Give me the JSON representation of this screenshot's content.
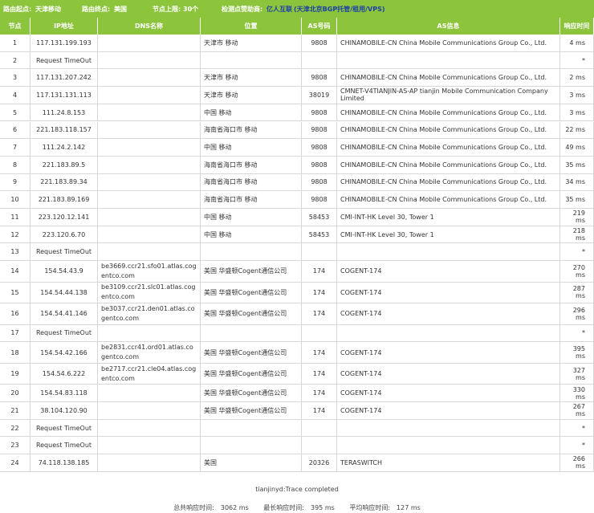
{
  "topbar": {
    "start_label": "路由起点:",
    "start_value": "天津移动",
    "end_label": "路由终点:",
    "end_value": "美国",
    "limit_label": "节点上限:",
    "limit_value": "30个",
    "sponsor_label": "检测点赞助商:",
    "sponsor_name": "亿人互联",
    "sponsor_desc": "(天津北京BGP托管/租用/VPS)"
  },
  "table": {
    "headers": [
      "节点",
      "IP地址",
      "DNS名称",
      "位置",
      "AS号码",
      "AS信息",
      "响应时间"
    ],
    "rows": [
      {
        "n": "1",
        "ip": "117.131.199.193",
        "dns": "",
        "loc": "天津市 移动",
        "as": "9808",
        "info": "CHINAMOBILE-CN China Mobile Communications Group Co., Ltd.",
        "t": "4 ms"
      },
      {
        "n": "2",
        "ip": "Request TimeOut",
        "dns": "",
        "loc": "",
        "as": "",
        "info": "",
        "t": "*"
      },
      {
        "n": "3",
        "ip": "117.131.207.242",
        "dns": "",
        "loc": "天津市 移动",
        "as": "9808",
        "info": "CHINAMOBILE-CN China Mobile Communications Group Co., Ltd.",
        "t": "2 ms"
      },
      {
        "n": "4",
        "ip": "117.131.131.113",
        "dns": "",
        "loc": "天津市 移动",
        "as": "38019",
        "info": "CMNET-V4TIANJIN-AS-AP tianjin Mobile Communication Company Limited",
        "t": "3 ms"
      },
      {
        "n": "5",
        "ip": "111.24.8.153",
        "dns": "",
        "loc": "中国 移动",
        "as": "9808",
        "info": "CHINAMOBILE-CN China Mobile Communications Group Co., Ltd.",
        "t": "3 ms"
      },
      {
        "n": "6",
        "ip": "221.183.118.157",
        "dns": "",
        "loc": "海南省海口市 移动",
        "as": "9808",
        "info": "CHINAMOBILE-CN China Mobile Communications Group Co., Ltd.",
        "t": "22 ms"
      },
      {
        "n": "7",
        "ip": "111.24.2.142",
        "dns": "",
        "loc": "中国 移动",
        "as": "9808",
        "info": "CHINAMOBILE-CN China Mobile Communications Group Co., Ltd.",
        "t": "49 ms"
      },
      {
        "n": "8",
        "ip": "221.183.89.5",
        "dns": "",
        "loc": "海南省海口市 移动",
        "as": "9808",
        "info": "CHINAMOBILE-CN China Mobile Communications Group Co., Ltd.",
        "t": "35 ms"
      },
      {
        "n": "9",
        "ip": "221.183.89.34",
        "dns": "",
        "loc": "海南省海口市 移动",
        "as": "9808",
        "info": "CHINAMOBILE-CN China Mobile Communications Group Co., Ltd.",
        "t": "34 ms"
      },
      {
        "n": "10",
        "ip": "221.183.89.169",
        "dns": "",
        "loc": "海南省海口市 移动",
        "as": "9808",
        "info": "CHINAMOBILE-CN China Mobile Communications Group Co., Ltd.",
        "t": "35 ms"
      },
      {
        "n": "11",
        "ip": "223.120.12.141",
        "dns": "",
        "loc": "中国 移动",
        "as": "58453",
        "info": "CMI-INT-HK Level 30, Tower 1",
        "t": "219 ms"
      },
      {
        "n": "12",
        "ip": "223.120.6.70",
        "dns": "",
        "loc": "中国 移动",
        "as": "58453",
        "info": "CMI-INT-HK Level 30, Tower 1",
        "t": "218 ms"
      },
      {
        "n": "13",
        "ip": "Request TimeOut",
        "dns": "",
        "loc": "",
        "as": "",
        "info": "",
        "t": "*"
      },
      {
        "n": "14",
        "ip": "154.54.43.9",
        "dns": "be3669.ccr21.sfo01.atlas.cogentco.com",
        "loc": "美国 华盛顿Cogent通信公司",
        "as": "174",
        "info": "COGENT-174",
        "t": "270 ms"
      },
      {
        "n": "15",
        "ip": "154.54.44.138",
        "dns": "be3109.ccr21.slc01.atlas.cogentco.com",
        "loc": "美国 华盛顿Cogent通信公司",
        "as": "174",
        "info": "COGENT-174",
        "t": "287 ms"
      },
      {
        "n": "16",
        "ip": "154.54.41.146",
        "dns": "be3037.ccr21.den01.atlas.cogentco.com",
        "loc": "美国 华盛顿Cogent通信公司",
        "as": "174",
        "info": "COGENT-174",
        "t": "296 ms"
      },
      {
        "n": "17",
        "ip": "Request TimeOut",
        "dns": "",
        "loc": "",
        "as": "",
        "info": "",
        "t": "*"
      },
      {
        "n": "18",
        "ip": "154.54.42.166",
        "dns": "be2831.ccr41.ord01.atlas.cogentco.com",
        "loc": "美国 华盛顿Cogent通信公司",
        "as": "174",
        "info": "COGENT-174",
        "t": "395 ms"
      },
      {
        "n": "19",
        "ip": "154.54.6.222",
        "dns": "be2717.ccr21.cle04.atlas.cogentco.com",
        "loc": "美国 华盛顿Cogent通信公司",
        "as": "174",
        "info": "COGENT-174",
        "t": "327 ms"
      },
      {
        "n": "20",
        "ip": "154.54.83.118",
        "dns": "",
        "loc": "美国 华盛顿Cogent通信公司",
        "as": "174",
        "info": "COGENT-174",
        "t": "330 ms"
      },
      {
        "n": "21",
        "ip": "38.104.120.90",
        "dns": "",
        "loc": "美国 华盛顿Cogent通信公司",
        "as": "174",
        "info": "COGENT-174",
        "t": "267 ms"
      },
      {
        "n": "22",
        "ip": "Request TimeOut",
        "dns": "",
        "loc": "",
        "as": "",
        "info": "",
        "t": "*"
      },
      {
        "n": "23",
        "ip": "Request TimeOut",
        "dns": "",
        "loc": "",
        "as": "",
        "info": "",
        "t": "*"
      },
      {
        "n": "24",
        "ip": "74.118.138.185",
        "dns": "",
        "loc": "美国",
        "as": "20326",
        "info": "TERASWITCH",
        "t": "266 ms"
      }
    ]
  },
  "footer": {
    "completed": "tianjinyd:Trace completed",
    "total_label": "总共响应时间:",
    "total_value": "3062 ms",
    "max_label": "最长响应时间:",
    "max_value": "395 ms",
    "avg_label": "平均响应时间:",
    "avg_value": "127 ms"
  },
  "colors": {
    "header_green": "#8cc43c",
    "link_blue": "#1b3fa8",
    "border": "#d8d8d8"
  }
}
